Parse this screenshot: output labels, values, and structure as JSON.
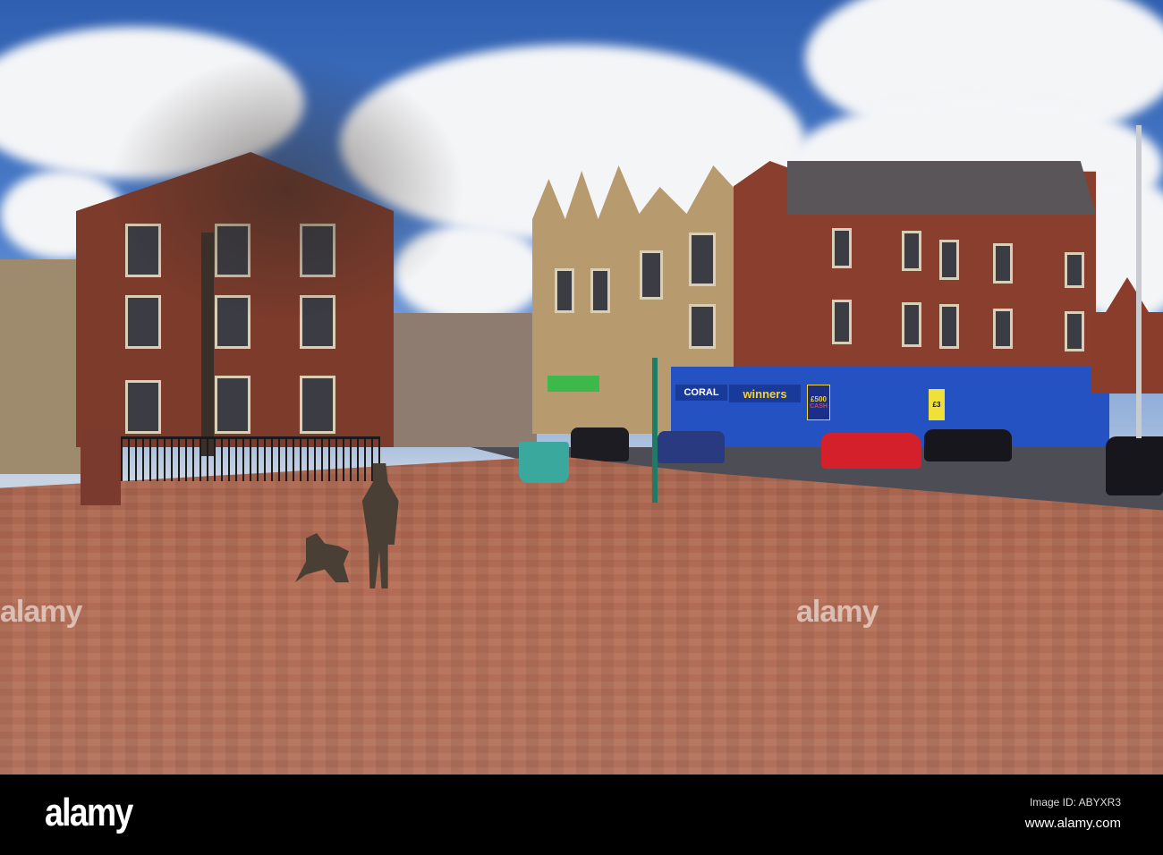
{
  "photo": {
    "shop_signs": {
      "coral": "CORAL",
      "winners": "winners",
      "prize": "£500",
      "prize_sub": "CASH",
      "poster": "£3"
    },
    "watermark": "alamy"
  },
  "footer": {
    "logo": "alamy",
    "image_id": "Image ID: ABYXR3",
    "url": "www.alamy.com"
  }
}
